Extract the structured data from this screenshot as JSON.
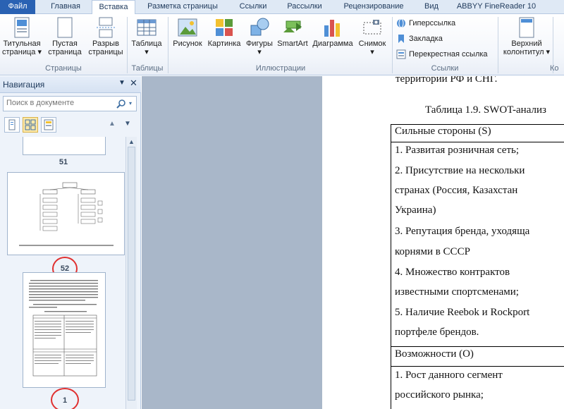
{
  "tabs": [
    {
      "label": "Файл"
    },
    {
      "label": "Главная"
    },
    {
      "label": "Вставка"
    },
    {
      "label": "Разметка страницы"
    },
    {
      "label": "Ссылки"
    },
    {
      "label": "Рассылки"
    },
    {
      "label": "Рецензирование"
    },
    {
      "label": "Вид"
    },
    {
      "label": "ABBYY FineReader 10"
    }
  ],
  "ribbon": {
    "pages": {
      "title_page": [
        "Титульная",
        "страница ▾"
      ],
      "blank_page": [
        "Пустая",
        "страница"
      ],
      "page_break": [
        "Разрыв",
        "страницы"
      ],
      "group": "Страницы"
    },
    "tables": {
      "table": [
        "Таблица",
        "▾"
      ],
      "group": "Таблицы"
    },
    "illustrations": {
      "picture": "Рисунок",
      "clipart": "Картинка",
      "shapes": "Фигуры",
      "smartart": "SmartArt",
      "chart": "Диаграмма",
      "screenshot": "Снимок",
      "shapes_arrow": "▾",
      "screenshot_arrow": "▾",
      "group": "Иллюстрации"
    },
    "links": {
      "hyperlink": "Гиперссылка",
      "bookmark": "Закладка",
      "crossref": "Перекрестная ссылка",
      "group": "Ссылки"
    },
    "header_footer": {
      "header": [
        "Верхний",
        "колонтитул ▾"
      ],
      "group": "Ко"
    }
  },
  "nav": {
    "title": "Навигация",
    "search_placeholder": "Поиск в документе",
    "pages": [
      {
        "number": "51"
      },
      {
        "number": "52"
      },
      {
        "number": "1"
      }
    ]
  },
  "document": {
    "top_line": "территории РФ и СНГ.",
    "table_caption": "Таблица 1.9. SWOT-анализ",
    "strengths_header": "Сильные стороны (S)",
    "s_items": [
      "1.  Развитая розничная сеть;",
      "2. Присутствие  на  нескольки",
      "странах   (Россия,   Казахстан",
      "Украина)",
      "3.  Репутация  бренда,  уходяща",
      "корнями в СССР",
      "4.  Множество      контрактов",
      "известными спортсменами;",
      "5.  Наличие  Reebok и Rockport",
      "портфеле брендов."
    ],
    "opportunities_header": "Возможности (O)",
    "o_items": [
      "1.     Рост     данного     сегмент",
      "российского рынка;"
    ]
  }
}
